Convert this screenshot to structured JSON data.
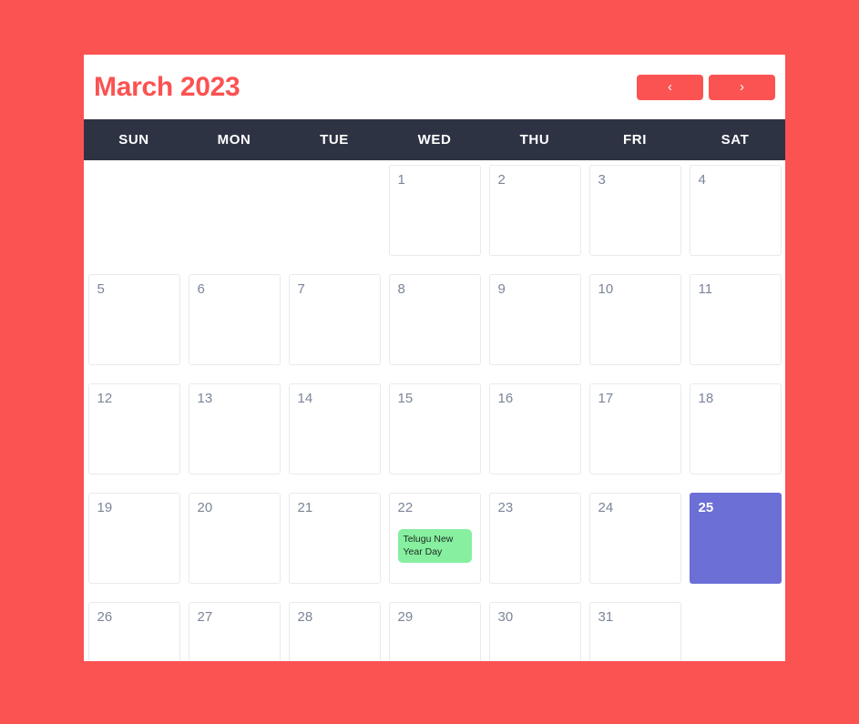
{
  "theme": {
    "page_background": "#fb5252",
    "accent": "#fb5252",
    "weekday_bar": "#2e3344",
    "selected_day": "#6b6fd6",
    "event_chip": "#86efa0",
    "day_number": "#7b8598",
    "cell_border": "#e9eaee"
  },
  "header": {
    "title": "March 2023",
    "prev_label": "‹",
    "next_label": "›",
    "prev_icon": "chevron-left-icon",
    "next_icon": "chevron-right-icon"
  },
  "weekdays": [
    "SUN",
    "MON",
    "TUE",
    "WED",
    "THU",
    "FRI",
    "SAT"
  ],
  "cells": [
    {
      "day": "",
      "blank": true,
      "selected": false,
      "event": ""
    },
    {
      "day": "",
      "blank": true,
      "selected": false,
      "event": ""
    },
    {
      "day": "",
      "blank": true,
      "selected": false,
      "event": ""
    },
    {
      "day": "1",
      "blank": false,
      "selected": false,
      "event": ""
    },
    {
      "day": "2",
      "blank": false,
      "selected": false,
      "event": ""
    },
    {
      "day": "3",
      "blank": false,
      "selected": false,
      "event": ""
    },
    {
      "day": "4",
      "blank": false,
      "selected": false,
      "event": ""
    },
    {
      "day": "5",
      "blank": false,
      "selected": false,
      "event": ""
    },
    {
      "day": "6",
      "blank": false,
      "selected": false,
      "event": ""
    },
    {
      "day": "7",
      "blank": false,
      "selected": false,
      "event": ""
    },
    {
      "day": "8",
      "blank": false,
      "selected": false,
      "event": ""
    },
    {
      "day": "9",
      "blank": false,
      "selected": false,
      "event": ""
    },
    {
      "day": "10",
      "blank": false,
      "selected": false,
      "event": ""
    },
    {
      "day": "11",
      "blank": false,
      "selected": false,
      "event": ""
    },
    {
      "day": "12",
      "blank": false,
      "selected": false,
      "event": ""
    },
    {
      "day": "13",
      "blank": false,
      "selected": false,
      "event": ""
    },
    {
      "day": "14",
      "blank": false,
      "selected": false,
      "event": ""
    },
    {
      "day": "15",
      "blank": false,
      "selected": false,
      "event": ""
    },
    {
      "day": "16",
      "blank": false,
      "selected": false,
      "event": ""
    },
    {
      "day": "17",
      "blank": false,
      "selected": false,
      "event": ""
    },
    {
      "day": "18",
      "blank": false,
      "selected": false,
      "event": ""
    },
    {
      "day": "19",
      "blank": false,
      "selected": false,
      "event": ""
    },
    {
      "day": "20",
      "blank": false,
      "selected": false,
      "event": ""
    },
    {
      "day": "21",
      "blank": false,
      "selected": false,
      "event": ""
    },
    {
      "day": "22",
      "blank": false,
      "selected": false,
      "event": "Telugu New Year Day"
    },
    {
      "day": "23",
      "blank": false,
      "selected": false,
      "event": ""
    },
    {
      "day": "24",
      "blank": false,
      "selected": false,
      "event": ""
    },
    {
      "day": "25",
      "blank": false,
      "selected": true,
      "event": ""
    },
    {
      "day": "26",
      "blank": false,
      "selected": false,
      "event": ""
    },
    {
      "day": "27",
      "blank": false,
      "selected": false,
      "event": ""
    },
    {
      "day": "28",
      "blank": false,
      "selected": false,
      "event": ""
    },
    {
      "day": "29",
      "blank": false,
      "selected": false,
      "event": ""
    },
    {
      "day": "30",
      "blank": false,
      "selected": false,
      "event": ""
    },
    {
      "day": "31",
      "blank": false,
      "selected": false,
      "event": ""
    },
    {
      "day": "",
      "blank": true,
      "selected": false,
      "event": ""
    }
  ]
}
